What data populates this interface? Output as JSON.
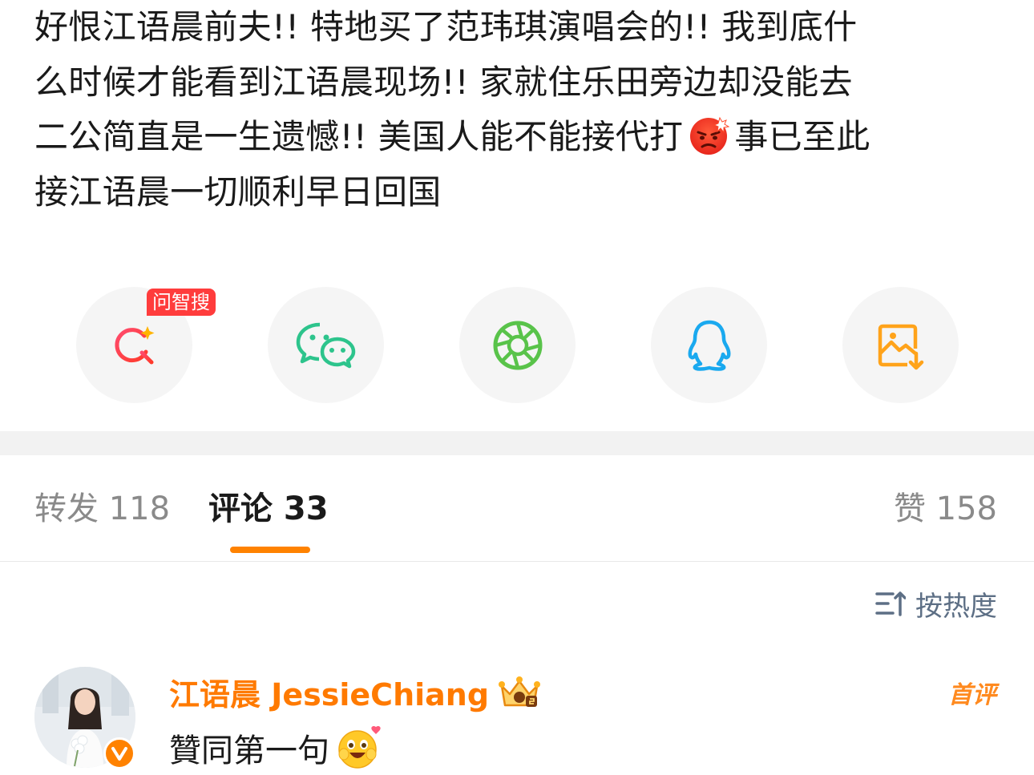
{
  "post": {
    "lines": [
      "好恨江语晨前夫!! 特地买了范玮琪演唱会的!! 我到底什",
      "么时候才能看到江语晨现场!! 家就住乐田旁边却没能去",
      "二公简直是一生遗憾!! 美国人能不能接代打",
      "接江语晨一切顺利早日回国"
    ],
    "line3_tail": "事已至此",
    "emoji": "angry-face-icon"
  },
  "share": {
    "badge": "问智搜",
    "items": [
      {
        "name": "ai-search-icon",
        "color": "#ff3b53"
      },
      {
        "name": "wechat-icon",
        "color": "#2dc48c"
      },
      {
        "name": "moments-icon",
        "color": "#59c34a"
      },
      {
        "name": "qq-icon",
        "color": "#1aa9ef"
      },
      {
        "name": "save-image-icon",
        "color": "#ffa31a"
      }
    ]
  },
  "tabs": {
    "repost": "转发 118",
    "comment": "评论 33",
    "like": "赞 158",
    "accent": "#ff8200"
  },
  "sort": {
    "label": "按热度"
  },
  "comment": {
    "author": "江语晨 JessieChiang",
    "tag": "首评",
    "text": "贊同第一句",
    "name_color": "#ff7a00"
  }
}
